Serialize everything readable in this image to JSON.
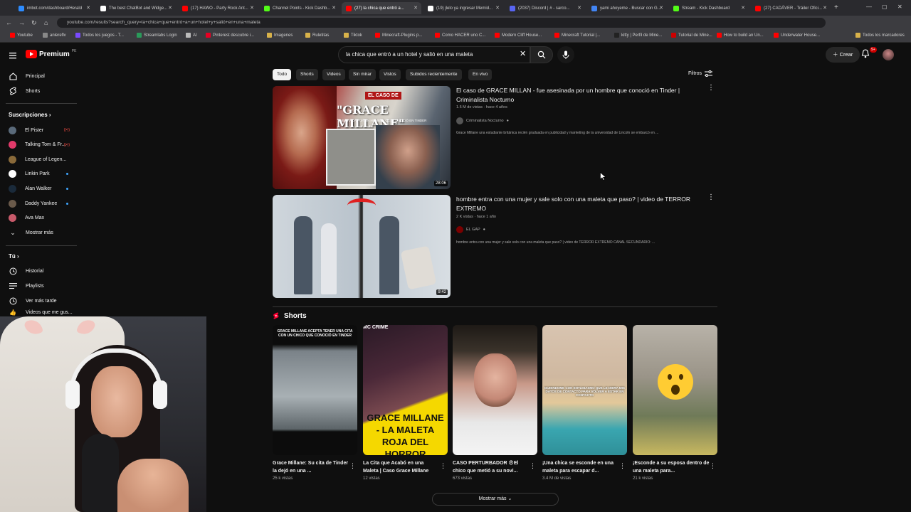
{
  "browser": {
    "tabs": [
      {
        "label": "imbot.com/dashboard/Herald",
        "fav": "#2d8cff"
      },
      {
        "label": "The best ChatBot and Widge...",
        "fav": "#ffffff"
      },
      {
        "label": "(17) HAWO - Party Rock Ant...",
        "fav": "#ff0000"
      },
      {
        "label": "Channel Points - Kick Dashb...",
        "fav": "#53fc18"
      },
      {
        "label": "(27) la chica que entró a...",
        "fav": "#ff0000"
      },
      {
        "label": "(19) jlelo ya ingresar Memid...",
        "fav": "#ffffff"
      },
      {
        "label": "(2037) Discord | # - sarco...",
        "fav": "#5865f2"
      },
      {
        "label": "yami ahoyeme - Buscar con G...",
        "fav": "#4285f4"
      },
      {
        "label": "Stream - Kick Dashboard",
        "fav": "#53fc18"
      },
      {
        "label": "(27) CADÁVER - Tráiler Ofici...",
        "fav": "#ff0000"
      }
    ],
    "url": "youtube.com/results?search_query=la+chica+que+entró+a+un+hotel+y+salió+en+una+maleta",
    "bookmarks": [
      "Youtube",
      "anlereflv",
      "Todos los juegos - T...",
      "Streamlabs Login",
      "AI",
      "Pinterest descubre i...",
      "Imagenes",
      "Ruletitas",
      "Tiktok",
      "Minecraft-Plugins p...",
      "Como HACER uno C...",
      "Modern Cliff House...",
      "Minecraft Tutorial |...",
      "kitty | Perfil de Mine...",
      "Tutorial de Mine...",
      "How to build an Un...",
      "Underwater House..."
    ],
    "all_bookmarks": "Todos los marcadores"
  },
  "header": {
    "logo_text": "Premium",
    "region": "PE",
    "search_query": "la chica que entró a un hotel y salió en una maleta",
    "create_label": "Crear",
    "notif_badge": "9+"
  },
  "sidebar": {
    "items": [
      {
        "label": "Principal",
        "icon": "home-icon"
      },
      {
        "label": "Shorts",
        "icon": "shorts-icon"
      }
    ],
    "subs_header": "Suscripciones",
    "subscriptions": [
      {
        "label": "El Pister",
        "color": "#5a6a7a",
        "status": "live"
      },
      {
        "label": "Talking Tom & Fr...",
        "color": "#e23a6a",
        "status": "live"
      },
      {
        "label": "League of Legen...",
        "color": "#8a6a3a",
        "status": "none"
      },
      {
        "label": "Linkin Park",
        "color": "#ffffff",
        "status": "dot"
      },
      {
        "label": "Alan Walker",
        "color": "#1a2a3a",
        "status": "dot"
      },
      {
        "label": "Daddy Yankee",
        "color": "#6a5a4a",
        "status": "dot"
      },
      {
        "label": "Ava Max",
        "color": "#c85a6a",
        "status": "none"
      }
    ],
    "show_more": "Mostrar más",
    "you_header": "Tú",
    "you_items": [
      {
        "label": "Historial",
        "icon": "history-icon"
      },
      {
        "label": "Playlists",
        "icon": "playlist-icon"
      },
      {
        "label": "Ver más tarde",
        "icon": "clock-icon"
      },
      {
        "label": "Videos que me gus...",
        "icon": "like-icon"
      }
    ]
  },
  "chips": [
    "Todo",
    "Shorts",
    "Videos",
    "Sin mirar",
    "Vistos",
    "Subidos recientemente",
    "En vivo"
  ],
  "filters_label": "Filtros",
  "results": [
    {
      "title": "El caso de GRACE MILLAN - fue asesinada por un hombre que conoció en Tinder | Criminalista Nocturno",
      "meta": "1.5 M de vistas · hace 4 años",
      "channel": "Criminalista Nocturno",
      "description": "Grace Millane una estudiante británica recién graduada en publicidad y marketing de la universidad de Lincoln se embarcó en ...",
      "duration": "28:06",
      "thumb_title": "\"GRACE MILLANE\"",
      "thumb_tag": "EL CASO DE",
      "thumb_sub": "ASESINADA POR UN HOMBRE QUE CONOCIÓ EN TINDER"
    },
    {
      "title": "hombre entra con una mujer y sale solo con una maleta que paso? | video de TERROR EXTREMO",
      "meta": "2 K vistas · hace 1 año",
      "channel": "EL GAP",
      "description": "hombre entra con una mujer y sale solo con una maleta que paso? | video de TERROR EXTREMO CANAL SECUNDARIO: ...",
      "duration": "9:42"
    }
  ],
  "shorts_header": "Shorts",
  "shorts": [
    {
      "title": "Grace Millane: Su cita de Tinder la dejó en una ...",
      "views": "25 k vistas",
      "overlay": "GRACE MILLANE ACEPTA TENER UNA CITA CON UN CHICO QUE CONOCIÓ EN TINDER"
    },
    {
      "title": "La Cita que Acabó en una Maleta | Caso Grace Millane",
      "views": "12 vistas",
      "overlay": "GRACE MILLANE - LA MALETA ROJA DEL HORROR",
      "tag": "MC CRIME"
    },
    {
      "title": "CASO PERTURBADOR 😨El chico que metió a su novi...",
      "views": "673 vistas"
    },
    {
      "title": "¡Una chica se esconde en una maleta para escapar d...",
      "views": "3.4 M de vistas",
      "overlay": "DIJIENDOME CON ENTUSIASMO QUE LE DIERA MIS DATOS DE CONTACTO PARA VOLVER A ESTAR EN CONTACTO"
    },
    {
      "title": "¡Esconde a su esposa dentro de una maleta para...",
      "views": "21 k vistas"
    }
  ],
  "show_more_label": "Mostrar más",
  "colors": {
    "bg": "#0f0f0f",
    "accent": "#ff0000",
    "chip": "#272727"
  }
}
